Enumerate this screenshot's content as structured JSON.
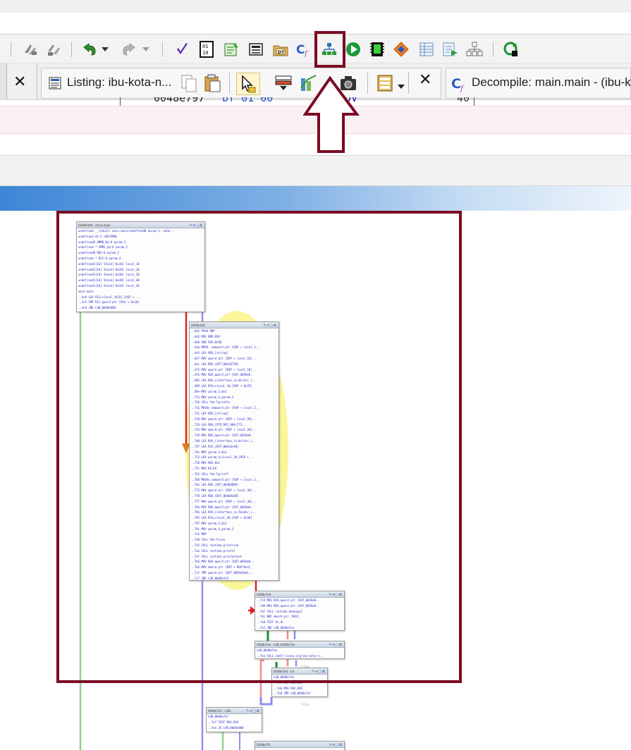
{
  "toolbar": {
    "icons": [
      "reverse-icon",
      "forward-icon",
      "undo-icon",
      "undo-dropdown-icon",
      "redo-icon",
      "redo-dropdown-icon",
      "check-icon",
      "bytes-icon",
      "script-icon",
      "memory-map-icon",
      "data-type-icon",
      "decompile-icon",
      "function-graph-icon",
      "run-icon",
      "program-icon",
      "symbol-icon",
      "table-icon",
      "export-icon",
      "tree-icon",
      "refresh-icon"
    ]
  },
  "tabs": {
    "listing_title": "Listing:  ibu-kota-n...",
    "decompile_title": "Decompile: main.main -  (ibu-k",
    "close_glyph": "✕"
  },
  "peek": {
    "address": "0048e797",
    "bytes": "bf 01 00",
    "mnemonic": "MOV",
    "line_number": "40"
  },
  "blocks": {
    "b1": {
      "title": "0048e4d0 - main.main",
      "lines": [
        "undefined __stdcall main.main(undefined8 param_1, unde...",
        "   undefined      AL:1           <RETURN>",
        "   undefined8     XMM0_Qa:8      param_1",
        "   undefined *    XMM1_Qa:8      param_2",
        "   undefined8     RDI:8          param_3",
        "   undefined *    RSI:8          param_4",
        "   undefined1[16] Stack[-0x10]   local_10",
        "   undefined1[16] Stack[-0x20]   local_20",
        "   undefined1[16] Stack[-0x30]   local_30",
        "   undefined1[16] Stack[-0x40]   local_40",
        "   undefined1[16] Stack[-0x50]   local_50",
        "                   main.main",
        " ..4c0 LEA   R12=>local_10[8],[RSP + -..",
        " ..4c5 CMP   R12,qword ptr [R14 + 0x10]",
        " ..4c9 JBE   LAB_0048e600"
      ]
    },
    "b2": {
      "title": "0048e4d2",
      "lines": [
        "..4d2 PUSH  RBP",
        "..4d3 MOV   RBP,RSP",
        "..4d6 SUB   RSP,0x98",
        "..4da MOVU. xmmword ptr [RSP + local_1..",
        "..4e3 LEA   RDX,[string]",
        "..4e7 MOV   qword ptr [RSP + local_18]..",
        "..4ec LEA   RDX,[DAT_004c0738]",
        "..473 MOV   qword ptr [RSP + local_18]..",
        "..47b MOV   RDX,qword ptr [DAT_0058e8..",
        "..482 LEA   RAX,[interface_io.Writer_i..",
        "..489 LEA   RCX=>local_18,[RSP + 0x78]",
        "..48e MOV   param_3,0x1",
        "..713 MOV   param_4,param_3",
        "..716 CALL  fmt.Fprintln",
        "..71b MOVUx xmmword ptr [RSP + local_2..",
        "..721 LEA   RDX,[string]",
        "..728 MOV   qword ptr [RSP + local_28]..",
        "..72d LEA   RDX,[PTR_DAT_004c773..",
        "..734 MOV   qword ptr [RSP + local_28]..",
        "..739 MOV   RDX,qword ptr [DAT_0058e8..",
        "..740 LEA   RAX,[interface_io.Writer_i..",
        "..747 LEA   RCX,[DAT_004c0c40]",
        "..74e MOV   param_3,0x1",
        "..753 LEA   param_4=>local_28,[RSP + ..",
        "..758 MOV   RDX,0x1",
        "..75c MOV   RX,RX",
        "..763 CALL  fmt.Fprintf",
        "..768 MOVUx xmmword ptr [RSP + local_3..",
        "..76e LEA   RDX,[DAT_004b8800]",
        "..773 MOV   qword ptr [RSP + local_30]..",
        "..778 LEA   RDX,[DAT_004b8a08]",
        "..77f MOV   qword ptr [RSP + local_30]..",
        "..784 MOV   RDX,qword ptr [DAT_0058e8..",
        "..78b LEA   RAX,[interface_io.Reader_i..",
        "..792 LEA   RCX=>local_38,[RSP + 0x58]",
        "..797 MOV   param_3,0x1",
        "..79c MOV   param_4,param_3",
        "..7a1 NOP",
        "..7a0 CALL  fmt.Fscan",
        "..7a5 CALL  runtime.printlock",
        "..7aa CALL  runtime.printnl",
        "..7af CALL  runtime.printunlock",
        "..7b4 MOV   RDX,qword ptr [DAT_0058e8..",
        "..7bb MOV   dword ptr [RSP + RDX*0x4]",
        "..7c2 CMP   qword ptr [DAT_0058e8a0],..",
        "..7c7 JNE   LAB_0048e7e5"
      ]
    },
    "b3": {
      "title": "0048e7c9",
      "lines": [
        "..7c9 MOV   RAX,qword ptr [DAT_0058e8..",
        "..7d0 MOV   RDX,qword ptr [DAT_0058e8..",
        "..7d7 CALL  runtime.memequal",
        "..7dc NOP   dword ptr [RAX]",
        "..7e0 TEST  AL,AL",
        "..7e2 JNE   LAB_0048e7ea"
      ]
    },
    "b4": {
      "title": "0048e7ea - LAB_0048e7ea",
      "lines": [
        "             LAB_0048e7ea",
        "..7ea CALL  cmdll-issue.org/ibu-kota-n.."
      ]
    },
    "b5": {
      "title": "0048e7e4 - LA",
      "lines": [
        "             LAB_0048e7e4",
        "..7e4 MOV   RDI,RDI",
        "..7e6 MOV   RAX,RAX",
        "..7e8 JMP   LAB_0048e7e7"
      ]
    },
    "b6": {
      "title": "0048e7e7 - LAB",
      "lines": [
        "             LAB_0048e7e7",
        "..7e7 TEST  RAX,RAX",
        "..7ea JE    LAB_0048e800"
      ]
    },
    "b7": {
      "title": "0048e7f4",
      "lines": []
    }
  },
  "edge_labels": {
    "false_1": "F-Can",
    "true_1": "T-Can"
  }
}
